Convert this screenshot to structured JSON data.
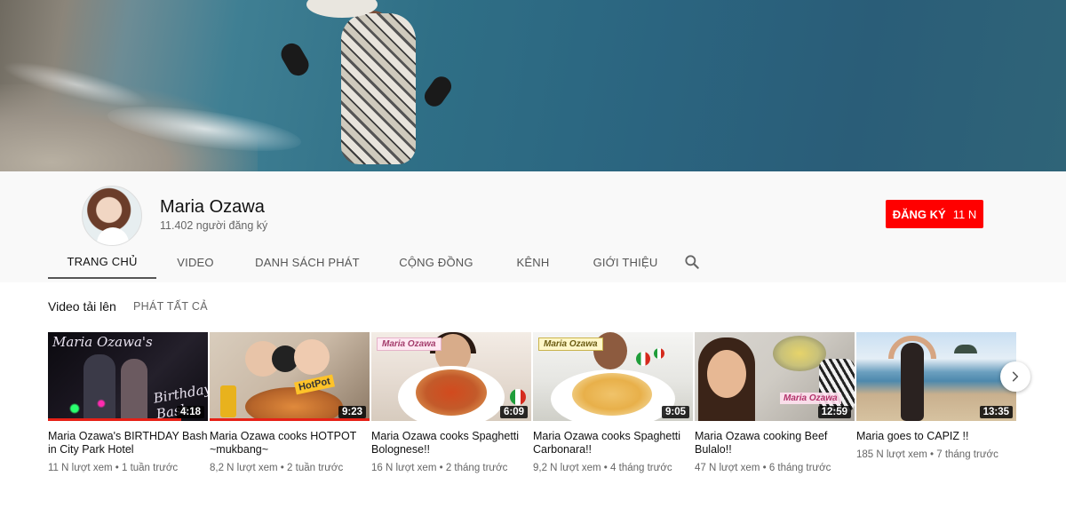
{
  "channel": {
    "name": "Maria Ozawa",
    "subscribers": "11.402 người đăng ký",
    "subscribe_label": "ĐĂNG KÝ",
    "subscribe_count": "11 N"
  },
  "tabs": [
    {
      "label": "TRANG CHỦ",
      "active": true
    },
    {
      "label": "VIDEO",
      "active": false
    },
    {
      "label": "DANH SÁCH PHÁT",
      "active": false
    },
    {
      "label": "CỘNG ĐỒNG",
      "active": false
    },
    {
      "label": "KÊNH",
      "active": false
    },
    {
      "label": "GIỚI THIỆU",
      "active": false
    }
  ],
  "section": {
    "title": "Video tải lên",
    "play_all": "PHÁT TẤT CẢ"
  },
  "videos": [
    {
      "title": "Maria Ozawa's BIRTHDAY Bash in City Park Hotel",
      "duration": "4:18",
      "views": "11 N lượt xem",
      "age": "1 tuần trước",
      "overlay": [
        "Maria Ozawa's",
        "Birthday Bash"
      ]
    },
    {
      "title": "Maria Ozawa cooks HOTPOT ~mukbang~",
      "duration": "9:23",
      "views": "8,2 N lượt xem",
      "age": "2 tuần trước",
      "overlay": [
        "HotPot"
      ]
    },
    {
      "title": "Maria Ozawa cooks Spaghetti Bolognese!!",
      "duration": "6:09",
      "views": "16 N lượt xem",
      "age": "2 tháng trước",
      "overlay": [
        "Maria Ozawa"
      ]
    },
    {
      "title": "Maria Ozawa cooks Spaghetti Carbonara!!",
      "duration": "9:05",
      "views": "9,2 N lượt xem",
      "age": "4 tháng trước",
      "overlay": [
        "Maria Ozawa"
      ]
    },
    {
      "title": "Maria Ozawa cooking Beef Bulalo!!",
      "duration": "12:59",
      "views": "47 N lượt xem",
      "age": "6 tháng trước",
      "overlay": [
        "Maria Ozawa"
      ]
    },
    {
      "title": "Maria goes to CAPIZ !!",
      "duration": "13:35",
      "views": "185 N lượt xem",
      "age": "7 tháng trước",
      "overlay": []
    }
  ],
  "meta_separator": "•",
  "colors": {
    "subscribe": "#ff0000",
    "progress": "#e62117",
    "header_bg": "#f9f9f9"
  },
  "icons": {
    "search": "search-icon",
    "next": "chevron-right-icon"
  }
}
